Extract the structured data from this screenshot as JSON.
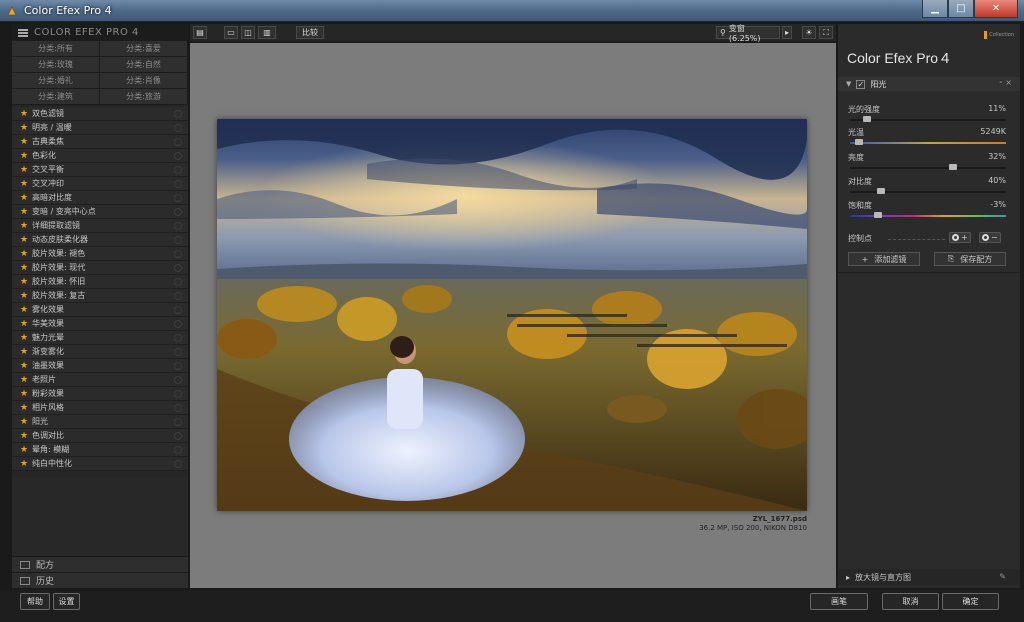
{
  "window": {
    "title": "Color Efex Pro 4",
    "buttons": {
      "minimize": "▁",
      "maximize": "□",
      "close": "✕"
    }
  },
  "left_panel": {
    "brand": "COLOR EFEX PRO 4",
    "categories": [
      "分类:所有",
      "分类:喜爱",
      "分类:玫瑰",
      "分类:自然",
      "分类:婚礼",
      "分类:肖像",
      "分类:建筑",
      "分类:旅游"
    ],
    "filters": [
      "双色滤镜",
      "明亮 / 温暖",
      "古典柔焦",
      "色彩化",
      "交叉平衡",
      "交叉冲印",
      "高暗对比度",
      "变暗 / 变亮中心点",
      "详细提取滤镜",
      "动态皮肤柔化器",
      "胶片效果: 褪色",
      "胶片效果: 现代",
      "胶片效果: 怀旧",
      "胶片效果: 复古",
      "雾化效果",
      "华美效果",
      "魅力光晕",
      "渐变雾化",
      "油墨效果",
      "老照片",
      "粉彩效果",
      "相片风格",
      "阳光",
      "色调对比",
      "晕角: 模糊",
      "纯白中性化"
    ],
    "sections": {
      "recipes": "配方",
      "history": "历史"
    }
  },
  "toolbar": {
    "compare_label": "比较",
    "zoom_label": "变窗 (6.25%)"
  },
  "preview": {
    "file_name": "ZYL_1677.psd",
    "file_meta": "36.2 MP, ISO 200, NIKON D810"
  },
  "right_panel": {
    "title": "Color Efex Pro",
    "title_num": "4",
    "logo_text": "Collection",
    "filter_name": "阳光",
    "sliders": [
      {
        "label": "光的强度",
        "value_text": "11%",
        "fraction": 0.11
      },
      {
        "label": "光温",
        "value_text": "5249K",
        "fraction": 0.06
      },
      {
        "label": "亮度",
        "value_text": "32%",
        "fraction": 0.66
      },
      {
        "label": "对比度",
        "value_text": "40%",
        "fraction": 0.2
      },
      {
        "label": "饱和度",
        "value_text": "-3%",
        "fraction": 0.18
      }
    ],
    "control_points": "控制点",
    "add_filter": "添加滤镜",
    "save_recipe": "保存配方",
    "loupe": "放大镜与直方图"
  },
  "bottom_bar": {
    "help": "帮助",
    "settings": "设置",
    "brush": "画笔",
    "cancel": "取消",
    "ok": "确定"
  },
  "colors": {
    "accent_star": "#e8a020",
    "panel_bg": "#2b2b2b",
    "preview_bg": "#7c7c7c"
  }
}
